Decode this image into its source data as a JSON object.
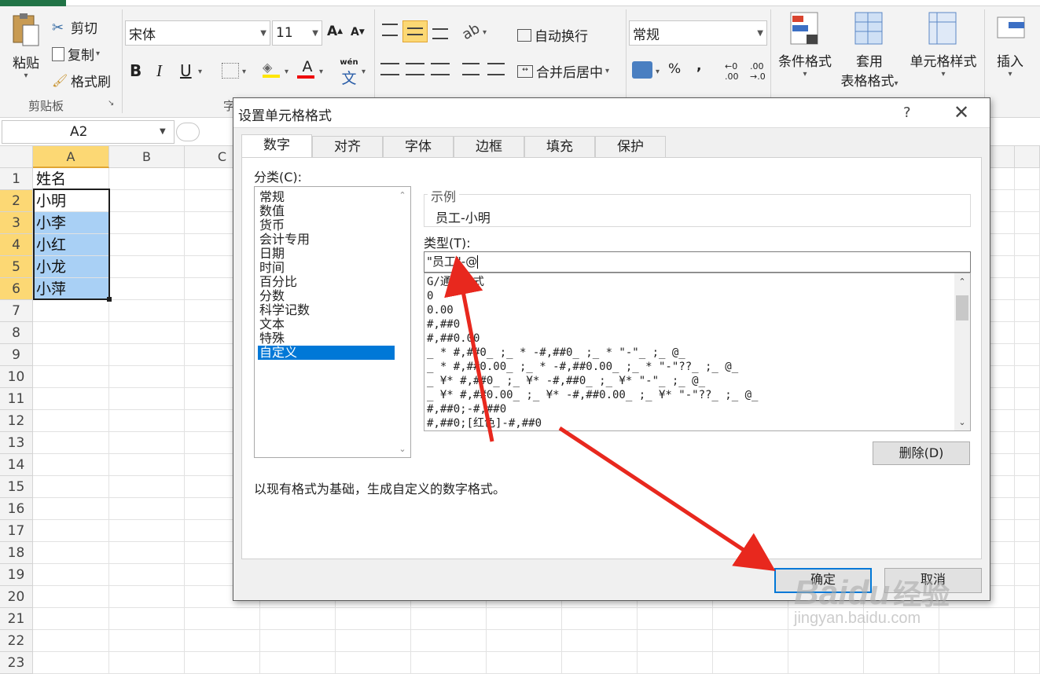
{
  "ribbon": {
    "clipboard": {
      "paste": "粘贴",
      "cut": "剪切",
      "copy": "复制",
      "format_painter": "格式刷",
      "group": "剪贴板"
    },
    "font": {
      "name": "宋体",
      "size": "11",
      "group": "字",
      "bold": "B",
      "italic": "I",
      "underline": "U",
      "wen": "wén"
    },
    "alignment": {
      "wrap": "自动换行",
      "merge": "合并后居中"
    },
    "number": {
      "format": "常规",
      "percent": "%",
      "comma": ","
    },
    "styles": {
      "conditional": "条件格式",
      "table_line1": "套用",
      "table_line2": "表格格式",
      "cell_styles": "单元格样式"
    },
    "cells": {
      "insert": "插入"
    }
  },
  "namebox": "A2",
  "grid": {
    "columns": [
      "A",
      "B",
      "C"
    ],
    "rows": [
      "1",
      "2",
      "3",
      "4",
      "5",
      "6",
      "7",
      "8",
      "9",
      "10",
      "11",
      "12",
      "13",
      "14",
      "15",
      "16",
      "17",
      "18",
      "19",
      "20",
      "21",
      "22",
      "23"
    ],
    "cells": [
      "姓名",
      "小明",
      "小李",
      "小红",
      "小龙",
      "小萍"
    ]
  },
  "dialog": {
    "title": "设置单元格格式",
    "help": "?",
    "tabs": [
      "数字",
      "对齐",
      "字体",
      "边框",
      "填充",
      "保护"
    ],
    "category_label": "分类(C):",
    "categories": [
      "常规",
      "数值",
      "货币",
      "会计专用",
      "日期",
      "时间",
      "百分比",
      "分数",
      "科学记数",
      "文本",
      "特殊",
      "自定义"
    ],
    "sample_label": "示例",
    "sample_value": "员工-小明",
    "type_label": "类型(T):",
    "type_value": "\"员工\"-@",
    "formats": [
      "G/通用格式",
      "0",
      "0.00",
      "#,##0",
      "#,##0.00",
      "_ * #,##0_ ;_ * -#,##0_ ;_ * \"-\"_ ;_ @_",
      "_ * #,##0.00_ ;_ * -#,##0.00_ ;_ * \"-\"??_ ;_ @_",
      "_ ¥* #,##0_ ;_ ¥* -#,##0_ ;_ ¥* \"-\"_ ;_ @_",
      "_ ¥* #,##0.00_ ;_ ¥* -#,##0.00_ ;_ ¥* \"-\"??_ ;_ @_",
      "#,##0;-#,##0",
      "#,##0;[红色]-#,##0"
    ],
    "delete_btn": "删除(D)",
    "description": "以现有格式为基础，生成自定义的数字格式。",
    "ok": "确定",
    "cancel": "取消"
  },
  "watermark": {
    "brand": "Baidu",
    "cn": "经验",
    "url": "jingyan.baidu.com"
  },
  "colors": {
    "accent": "#217346",
    "selection": "#0078d7",
    "arrow": "#e8281e",
    "cell_highlight": "#a9d0f5"
  }
}
